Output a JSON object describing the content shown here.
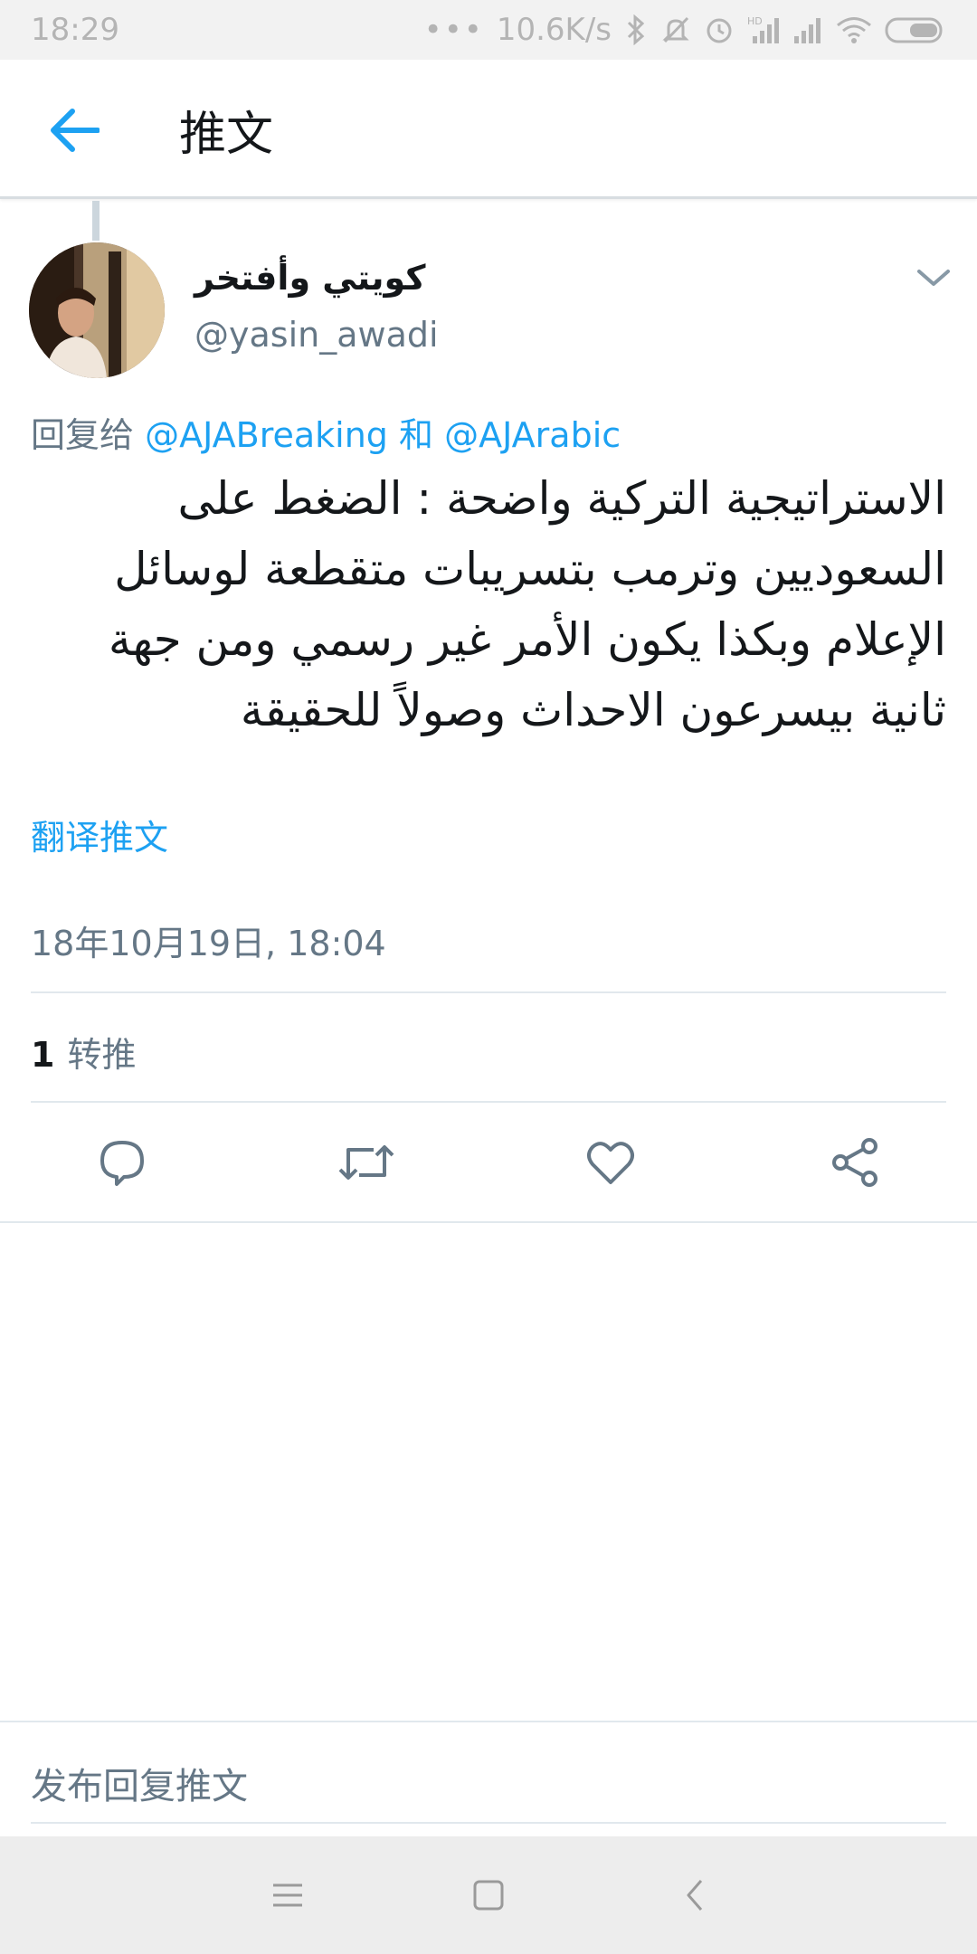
{
  "status_bar": {
    "time": "18:29",
    "dots": "•••",
    "network_speed": "10.6K/s"
  },
  "header": {
    "title": "推文",
    "back_icon": "arrow-left-icon",
    "accent_color": "#1da1f2"
  },
  "tweet": {
    "display_name": "كويتي وأفتخر",
    "handle": "@yasin_awadi",
    "reply_prefix": "回复给",
    "reply_mention_1": "@AJABreaking",
    "reply_conjunction": "和",
    "reply_mention_2": "@AJArabic",
    "text": "الاستراتيجية التركية واضحة : الضغط على السعوديين وترمب بتسريبات متقطعة لوسائل الإعلام وبكذا يكون الأمر غير رسمي ومن جهة ثانية بيسرعون الاحداث وصولاً للحقيقة",
    "translate_label": "翻译推文",
    "timestamp": "18年10月19日, 18:04",
    "retweet_count": "1",
    "retweet_label": "转推"
  },
  "actions": {
    "reply_icon": "reply-icon",
    "retweet_icon": "retweet-icon",
    "like_icon": "heart-icon",
    "share_icon": "share-icon"
  },
  "composer": {
    "placeholder": "发布回复推文"
  },
  "nav": {
    "menu_icon": "menu-icon",
    "home_icon": "home-square-icon",
    "back_icon": "back-chevron-icon"
  }
}
